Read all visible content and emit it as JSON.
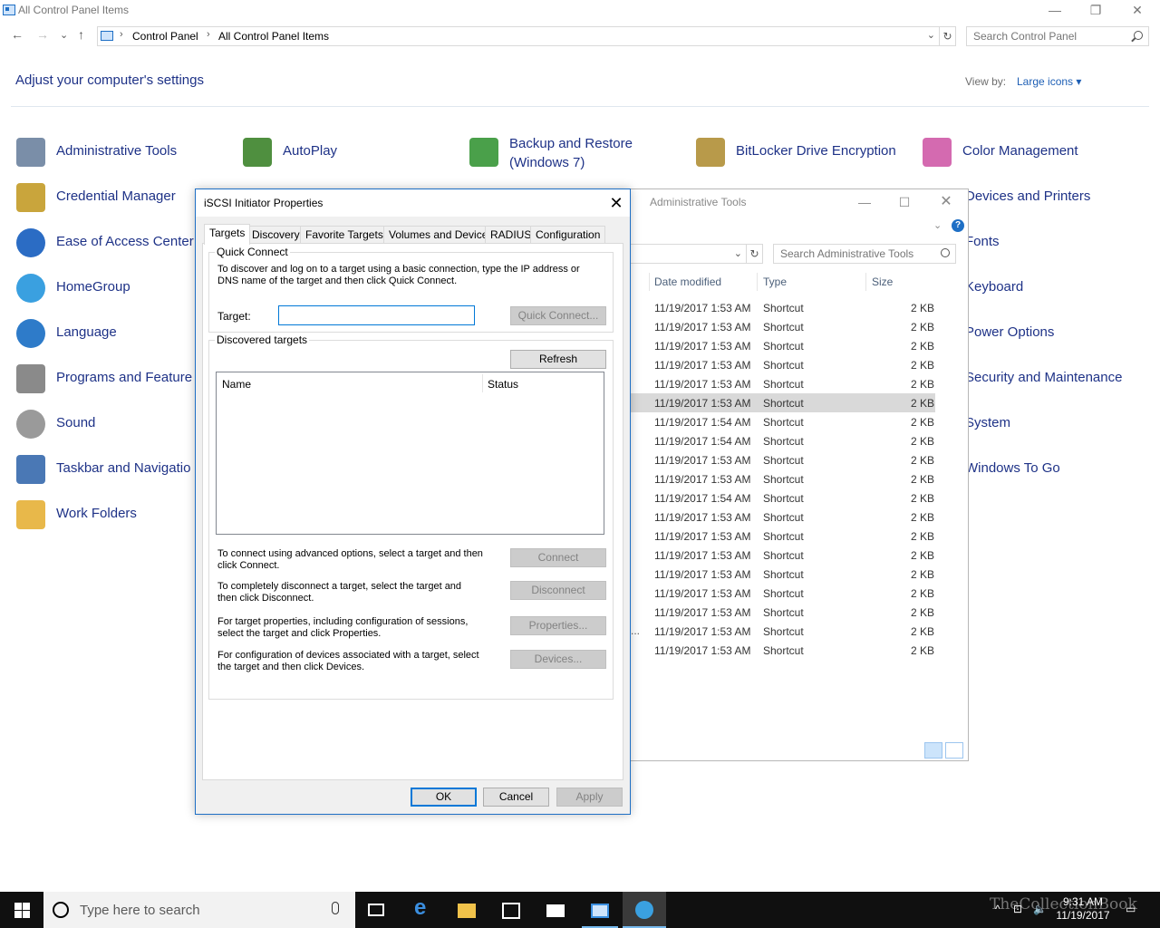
{
  "control_panel": {
    "window_title": "All Control Panel Items",
    "window_buttons": {
      "minimize": "—",
      "restore": "❐",
      "close": "✕"
    },
    "nav": {
      "back": "←",
      "forward": "→",
      "recent": "⌄",
      "up": "↑"
    },
    "breadcrumb": [
      "Control Panel",
      "All Control Panel Items"
    ],
    "search_placeholder": "Search Control Panel",
    "heading": "Adjust your computer's settings",
    "view_by_label": "View by:",
    "view_by_value": "Large icons ▾",
    "items_left": [
      {
        "label": "Administrative Tools",
        "icon": "admin-tools-icon",
        "color": "#7a8ea8"
      },
      {
        "label": "Credential Manager",
        "icon": "credential-manager-icon",
        "color": "#c9a53c"
      },
      {
        "label": "Ease of Access Center",
        "icon": "ease-of-access-icon",
        "color": "#2b6cc4"
      },
      {
        "label": "HomeGroup",
        "icon": "homegroup-icon",
        "color": "#3aa0e0"
      },
      {
        "label": "Language",
        "icon": "language-icon",
        "color": "#2e7bc9"
      },
      {
        "label": "Programs and Feature",
        "icon": "programs-features-icon",
        "color": "#8a8a8a"
      },
      {
        "label": "Sound",
        "icon": "sound-icon",
        "color": "#9a9a9a"
      },
      {
        "label": "Taskbar and Navigatio",
        "icon": "taskbar-navigation-icon",
        "color": "#4a78b5"
      },
      {
        "label": "Work Folders",
        "icon": "work-folders-icon",
        "color": "#e8b84a"
      }
    ],
    "items_top": [
      {
        "label": "AutoPlay",
        "icon": "autoplay-icon",
        "color": "#4f8f3f"
      },
      {
        "label": "Backup and Restore",
        "label2": "(Windows 7)",
        "icon": "backup-restore-icon",
        "color": "#4aa04a"
      },
      {
        "label": "BitLocker Drive Encryption",
        "icon": "bitlocker-icon",
        "color": "#b89a4a"
      },
      {
        "label": "Color Management",
        "icon": "color-management-icon",
        "color": "#d46ab0"
      }
    ],
    "items_right": [
      {
        "label": "Devices and Printers"
      },
      {
        "label": "Fonts"
      },
      {
        "label": "Keyboard"
      },
      {
        "label": "Power Options"
      },
      {
        "label": "Security and Maintenance"
      },
      {
        "label": "System"
      },
      {
        "label": "Windows To Go"
      }
    ]
  },
  "admin_tools": {
    "window_title": "Administrative Tools",
    "search_placeholder": "Search Administrative Tools",
    "columns": {
      "date": "Date modified",
      "type": "Type",
      "size": "Size"
    },
    "rows": [
      {
        "date": "11/19/2017 1:53 AM",
        "type": "Shortcut",
        "size": "2 KB"
      },
      {
        "date": "11/19/2017 1:53 AM",
        "type": "Shortcut",
        "size": "2 KB"
      },
      {
        "date": "11/19/2017 1:53 AM",
        "type": "Shortcut",
        "size": "2 KB"
      },
      {
        "date": "11/19/2017 1:53 AM",
        "type": "Shortcut",
        "size": "2 KB"
      },
      {
        "date": "11/19/2017 1:53 AM",
        "type": "Shortcut",
        "size": "2 KB"
      },
      {
        "date": "11/19/2017 1:53 AM",
        "type": "Shortcut",
        "size": "2 KB",
        "selected": true
      },
      {
        "date": "11/19/2017 1:54 AM",
        "type": "Shortcut",
        "size": "2 KB"
      },
      {
        "date": "11/19/2017 1:54 AM",
        "type": "Shortcut",
        "size": "2 KB"
      },
      {
        "date": "11/19/2017 1:53 AM",
        "type": "Shortcut",
        "size": "2 KB"
      },
      {
        "date": "11/19/2017 1:53 AM",
        "type": "Shortcut",
        "size": "2 KB"
      },
      {
        "date": "11/19/2017 1:54 AM",
        "type": "Shortcut",
        "size": "2 KB"
      },
      {
        "date": "11/19/2017 1:53 AM",
        "type": "Shortcut",
        "size": "2 KB"
      },
      {
        "date": "11/19/2017 1:53 AM",
        "type": "Shortcut",
        "size": "2 KB"
      },
      {
        "date": "11/19/2017 1:53 AM",
        "type": "Shortcut",
        "size": "2 KB"
      },
      {
        "date": "11/19/2017 1:53 AM",
        "type": "Shortcut",
        "size": "2 KB"
      },
      {
        "date": "11/19/2017 1:53 AM",
        "type": "Shortcut",
        "size": "2 KB"
      },
      {
        "date": "11/19/2017 1:53 AM",
        "type": "Shortcut",
        "size": "2 KB"
      },
      {
        "date": "11/19/2017 1:53 AM",
        "type": "Shortcut",
        "size": "2 KB"
      },
      {
        "date": "11/19/2017 1:53 AM",
        "type": "Shortcut",
        "size": "2 KB"
      }
    ],
    "truncated_marker": "..."
  },
  "dialog": {
    "title": "iSCSI Initiator Properties",
    "close": "✕",
    "tabs": [
      "Targets",
      "Discovery",
      "Favorite Targets",
      "Volumes and Devices",
      "RADIUS",
      "Configuration"
    ],
    "active_tab": "Targets",
    "quick_connect": {
      "group_title": "Quick Connect",
      "description": "To discover and log on to a target using a basic connection, type the IP address or DNS name of the target and then click Quick Connect.",
      "target_label": "Target:",
      "target_value": "",
      "button": "Quick Connect..."
    },
    "discovered": {
      "group_title": "Discovered targets",
      "refresh_button": "Refresh",
      "columns": [
        "Name",
        "Status"
      ]
    },
    "actions": [
      {
        "text": "To connect using advanced options, select a target and then click Connect.",
        "button": "Connect"
      },
      {
        "text": "To completely disconnect a target, select the target and then click Disconnect.",
        "button": "Disconnect"
      },
      {
        "text": "For target properties, including configuration of sessions, select the target and click Properties.",
        "button": "Properties..."
      },
      {
        "text": "For configuration of devices associated with a target, select the target and then click Devices.",
        "button": "Devices..."
      }
    ],
    "footer": {
      "ok": "OK",
      "cancel": "Cancel",
      "apply": "Apply"
    }
  },
  "taskbar": {
    "search_placeholder": "Type here to search",
    "time": "9:31 AM",
    "date": "11/19/2017",
    "watermark": "TheCollectionBook",
    "tray_icons": [
      "^",
      "⊡",
      "🔈",
      "▭"
    ]
  }
}
